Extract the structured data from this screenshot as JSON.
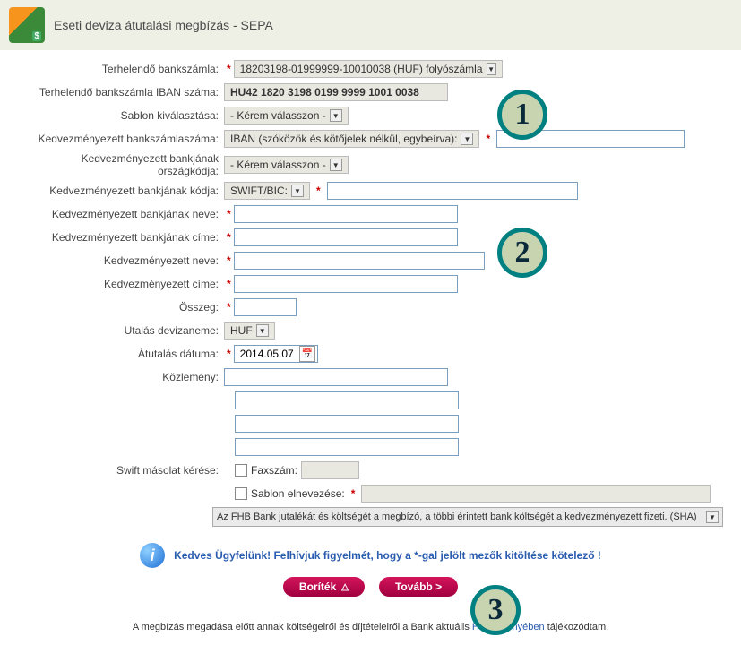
{
  "header": {
    "title": "Eseti deviza átutalási megbízás - SEPA"
  },
  "labels": {
    "account": "Terhelendő bankszámla:",
    "iban_label": "Terhelendő bankszámla IBAN száma:",
    "template": "Sablon kiválasztása:",
    "bene_account": "Kedvezményezett bankszámlaszáma:",
    "bene_bank_country": "Kedvezményezett bankjának országkódja:",
    "bene_bank_code": "Kedvezményezett bankjának kódja:",
    "bene_bank_name": "Kedvezményezett bankjának neve:",
    "bene_bank_addr": "Kedvezményezett bankjának címe:",
    "bene_name": "Kedvezményezett neve:",
    "bene_addr": "Kedvezményezett címe:",
    "amount": "Összeg:",
    "currency": "Utalás devizaneme:",
    "date": "Átutalás dátuma:",
    "remark": "Közlemény:",
    "swift_copy": "Swift másolat kérése:",
    "fax": "Faxszám:",
    "save_template": "Sablon elnevezése:"
  },
  "values": {
    "account": "18203198-01999999-10010038 (HUF) folyószámla",
    "iban": "HU42 1820 3198 0199 9999 1001 0038",
    "template_sel": "- Kérem válasszon -",
    "bene_acc_type": "IBAN (szóközök és kötőjelek nélkül, egybeírva):",
    "country_sel": "- Kérem válasszon -",
    "swift_label": "SWIFT/BIC:",
    "currency": "HUF",
    "date": "2014.05.07",
    "cost_bearing": "Az FHB Bank jutalékát és költségét a megbízó, a többi érintett bank költségét a kedvezményezett fizeti. (SHA)"
  },
  "info": "Kedves Ügyfelünk! Felhívjuk figyelmét, hogy a *-gal jelölt mezők kitöltése kötelező !",
  "buttons": {
    "envelope": "Boríték",
    "next": "Tovább >"
  },
  "footer": {
    "t1": "A megbízás megadása előtt annak költségeiről és díjtételeiről a Bank aktuális ",
    "link": "Hirdetményében",
    "t2": " tájékozódtam."
  },
  "badges": {
    "b1": "1",
    "b2": "2",
    "b3": "3"
  }
}
